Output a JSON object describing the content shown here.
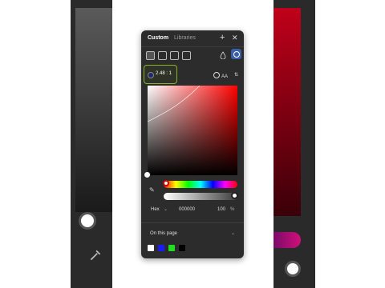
{
  "panel": {
    "tabs": [
      "Custom",
      "Libraries"
    ]
  },
  "icons": [
    "plus-icon",
    "close-icon",
    "solid-fill-icon",
    "linear-gradient-icon",
    "image-fill-icon",
    "video-fill-icon",
    "eyedropper-icon",
    "blend-icon",
    "no-contrast-icon",
    "adjust-icon"
  ],
  "contrast": {
    "ratio": "2.48 : 1",
    "aa_label": "AA"
  },
  "picker": {
    "hue_color": "#ff0000",
    "selected_color": "#000000",
    "hue_fraction": 0.0,
    "alpha_fraction": 1.0
  },
  "values": {
    "mode": "Hex",
    "hex": "000000",
    "opacity": "100",
    "opacity_unit": "%"
  },
  "library": {
    "selected": "On this page"
  },
  "swatches": [
    {
      "color": "#ffffff"
    },
    {
      "color": "#1a1aff"
    },
    {
      "color": "#22dd22"
    },
    {
      "color": "#000000"
    }
  ]
}
